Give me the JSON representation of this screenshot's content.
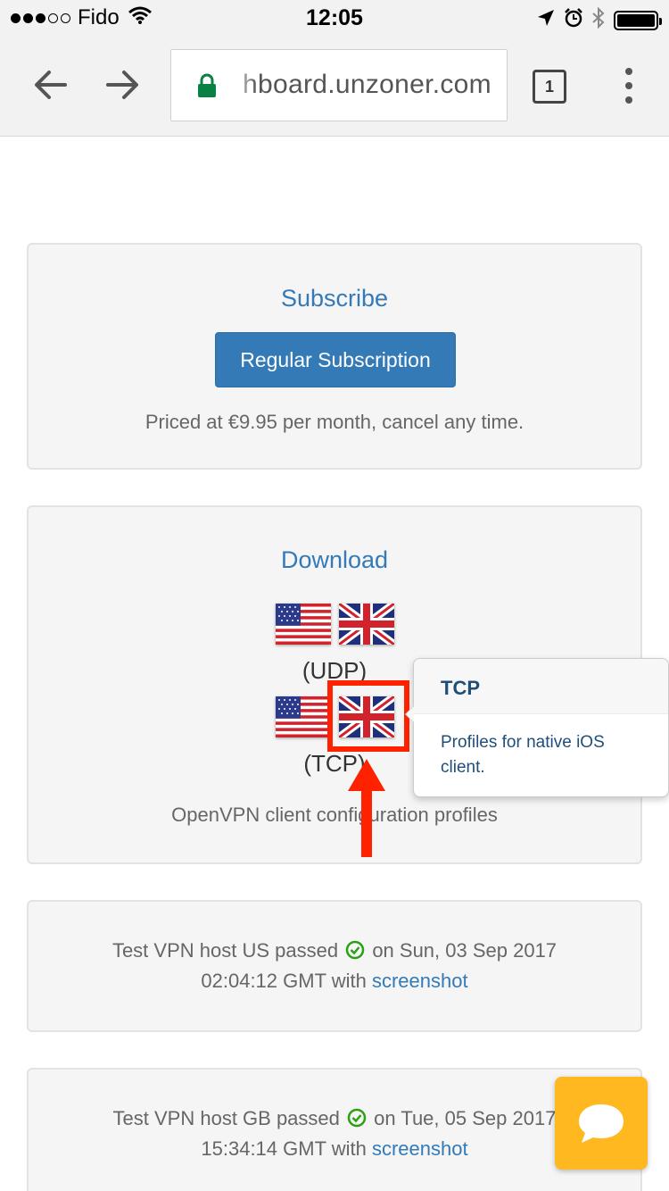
{
  "status_bar": {
    "carrier": "Fido",
    "time": "12:05"
  },
  "browser": {
    "url": "hboard.unzoner.com",
    "tab_count": "1"
  },
  "subscribe": {
    "title": "Subscribe",
    "button_label": "Regular Subscription",
    "price_text": "Priced at €9.95 per month, cancel any time."
  },
  "download": {
    "title": "Download",
    "udp_label": "(UDP)",
    "tcp_label": "(TCP)",
    "caption": "OpenVPN client configuration profiles"
  },
  "popover": {
    "title": "TCP",
    "body": "Profiles for native iOS client."
  },
  "tests": [
    {
      "prefix": "Test VPN host US passed",
      "suffix": "on Sun, 03 Sep 2017",
      "time": "02:04:12 GMT with",
      "link": "screenshot"
    },
    {
      "prefix": "Test VPN host GB passed",
      "suffix": "on Tue, 05 Sep 2017",
      "time": "15:34:14 GMT with",
      "link": "screenshot"
    }
  ],
  "colors": {
    "link": "#337ab7",
    "button": "#337ab7",
    "highlight": "#ff2200",
    "check": "#2aa012",
    "chat": "#ffb81f"
  },
  "icons": [
    "back-arrow-icon",
    "forward-arrow-icon",
    "lock-icon",
    "tabs-icon",
    "more-vert-icon",
    "us-flag-icon",
    "gb-flag-icon",
    "check-circle-icon",
    "chat-bubble-icon",
    "wifi-icon",
    "location-icon",
    "alarm-icon",
    "bluetooth-icon",
    "battery-icon"
  ]
}
